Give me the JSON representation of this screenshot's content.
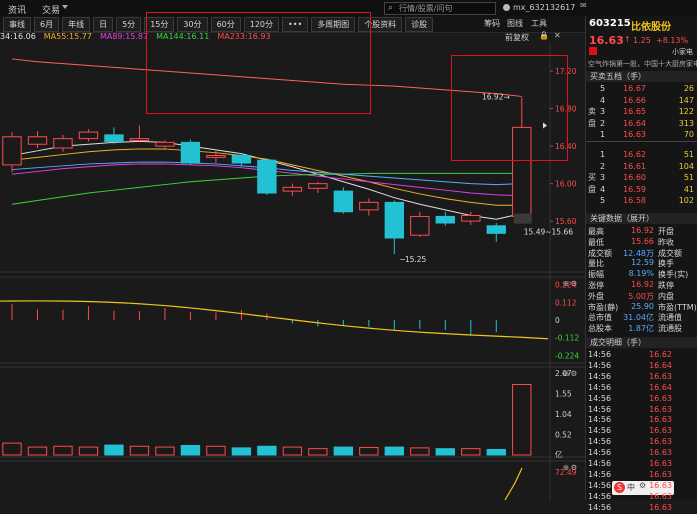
{
  "topbar": {
    "menu": [
      "资讯",
      "交易"
    ],
    "search_placeholder": "行情/股票/问句",
    "account": "mx_632132617",
    "right_tools": [
      "筹码",
      "图线",
      "工具"
    ]
  },
  "toolbar": {
    "buttons": [
      "事线",
      "6月",
      "年线",
      "日",
      "5分",
      "15分",
      "30分",
      "60分",
      "120分",
      "•••",
      "多周期图",
      "个股资料",
      "诊股"
    ],
    "right_label": "前复权"
  },
  "ma_legend": [
    {
      "text": "34:16.06",
      "color": "#e0e0e0"
    },
    {
      "text": "MA55:15.77",
      "color": "#f0b020"
    },
    {
      "text": "MA89:15.87",
      "color": "#e040e0"
    },
    {
      "text": "MA144:16.11",
      "color": "#3ad33a"
    },
    {
      "text": "MA233:16.93",
      "color": "#ff4b4b"
    }
  ],
  "price_axis": [
    "17.20",
    "16.80",
    "16.40",
    "16.00",
    "15.60"
  ],
  "price_annotations": {
    "high": "16.92",
    "low": "15.25",
    "range": "15.49~15.66"
  },
  "macd_axis": [
    "0.224",
    "0.112",
    "0",
    "-0.112",
    "-0.224"
  ],
  "vol_axis": [
    "2.07",
    "1.55",
    "1.04",
    "0.52",
    "亿"
  ],
  "bottom_axis": [
    "72.49"
  ],
  "chart_data": {
    "type": "candlestick",
    "candles": [
      {
        "o": 16.2,
        "c": 16.5,
        "h": 16.55,
        "l": 16.12
      },
      {
        "o": 16.42,
        "c": 16.5,
        "h": 16.56,
        "l": 16.38
      },
      {
        "o": 16.38,
        "c": 16.48,
        "h": 16.52,
        "l": 16.34
      },
      {
        "o": 16.48,
        "c": 16.55,
        "h": 16.58,
        "l": 16.45
      },
      {
        "o": 16.52,
        "c": 16.45,
        "h": 16.6,
        "l": 16.42
      },
      {
        "o": 16.46,
        "c": 16.48,
        "h": 16.62,
        "l": 16.44
      },
      {
        "o": 16.4,
        "c": 16.44,
        "h": 16.46,
        "l": 16.36
      },
      {
        "o": 16.44,
        "c": 16.22,
        "h": 16.47,
        "l": 16.2
      },
      {
        "o": 16.28,
        "c": 16.3,
        "h": 16.35,
        "l": 16.22
      },
      {
        "o": 16.3,
        "c": 16.22,
        "h": 16.32,
        "l": 16.18
      },
      {
        "o": 16.25,
        "c": 15.9,
        "h": 16.27,
        "l": 15.88
      },
      {
        "o": 15.92,
        "c": 15.96,
        "h": 16.0,
        "l": 15.87
      },
      {
        "o": 15.95,
        "c": 16.0,
        "h": 16.02,
        "l": 15.9
      },
      {
        "o": 15.92,
        "c": 15.7,
        "h": 15.96,
        "l": 15.68
      },
      {
        "o": 15.72,
        "c": 15.8,
        "h": 15.84,
        "l": 15.66
      },
      {
        "o": 15.8,
        "c": 15.42,
        "h": 15.82,
        "l": 15.25
      },
      {
        "o": 15.45,
        "c": 15.65,
        "h": 15.7,
        "l": 15.43
      },
      {
        "o": 15.65,
        "c": 15.58,
        "h": 15.7,
        "l": 15.55
      },
      {
        "o": 15.6,
        "c": 15.66,
        "h": 15.7,
        "l": 15.56
      },
      {
        "o": 15.55,
        "c": 15.47,
        "h": 15.58,
        "l": 15.38
      },
      {
        "o": 15.65,
        "c": 16.6,
        "h": 16.92,
        "l": 15.63
      }
    ],
    "volumes": [
      0.3,
      0.2,
      0.22,
      0.2,
      0.25,
      0.22,
      0.2,
      0.24,
      0.22,
      0.18,
      0.22,
      0.2,
      0.16,
      0.2,
      0.19,
      0.2,
      0.18,
      0.16,
      0.16,
      0.14,
      1.78
    ],
    "price_range": [
      15.1,
      17.5
    ],
    "volume_max": 2.07
  },
  "stock": {
    "code": "603215",
    "name": "比依股份",
    "price": "16.63",
    "change": "1.25",
    "pct": "+8.13%",
    "flag": "小家电",
    "desc": "空气炸锅第一股，中国十大厨房家电"
  },
  "order_book": {
    "title": "买卖五档（手）",
    "sell_label": "卖盘",
    "buy_label": "买盘",
    "sells": [
      {
        "n": "5",
        "p": "16.67",
        "v": "26"
      },
      {
        "n": "4",
        "p": "16.66",
        "v": "147"
      },
      {
        "n": "3",
        "p": "16.65",
        "v": "122"
      },
      {
        "n": "2",
        "p": "16.64",
        "v": "313"
      },
      {
        "n": "1",
        "p": "16.63",
        "v": "70"
      }
    ],
    "buys": [
      {
        "n": "1",
        "p": "16.62",
        "v": "51"
      },
      {
        "n": "2",
        "p": "16.61",
        "v": "104"
      },
      {
        "n": "3",
        "p": "16.60",
        "v": "51"
      },
      {
        "n": "4",
        "p": "16.59",
        "v": "41"
      },
      {
        "n": "5",
        "p": "16.58",
        "v": "102"
      }
    ]
  },
  "key_data": {
    "title": "关键数据（展开）",
    "rows": [
      {
        "l1": "最高",
        "v1": "16.92",
        "l2": "开盘",
        "c": "red"
      },
      {
        "l1": "最低",
        "v1": "15.66",
        "l2": "昨收",
        "c": "red"
      },
      {
        "l1": "成交额",
        "v1": "12.48万",
        "l2": "成交额",
        "c": "wht"
      },
      {
        "l1": "量比",
        "v1": "12.59",
        "l2": "换手",
        "c": "wht"
      },
      {
        "l1": "振幅",
        "v1": "8.19%",
        "l2": "换手(实)",
        "c": "wht"
      },
      {
        "l1": "涨停",
        "v1": "16.92",
        "l2": "跌停",
        "c": "red"
      },
      {
        "l1": "外盘",
        "v1": "5.00万",
        "l2": "内盘",
        "c": "red"
      },
      {
        "l1": "市盈(静)",
        "v1": "25.90",
        "l2": "市盈(TTM)",
        "c": "wht"
      },
      {
        "l1": "总市值",
        "v1": "31.04亿",
        "l2": "流通值",
        "c": "wht"
      },
      {
        "l1": "总股本",
        "v1": "1.87亿",
        "l2": "流通股",
        "c": "wht"
      }
    ]
  },
  "ticks": {
    "title": "成交明细（手）",
    "rows": [
      {
        "t": "14:56",
        "p": "16.62"
      },
      {
        "t": "14:56",
        "p": "16.64"
      },
      {
        "t": "14:56",
        "p": "16.63"
      },
      {
        "t": "14:56",
        "p": "16.64"
      },
      {
        "t": "14:56",
        "p": "16.63"
      },
      {
        "t": "14:56",
        "p": "16.63"
      },
      {
        "t": "14:56",
        "p": "16.63"
      },
      {
        "t": "14:56",
        "p": "16.63"
      },
      {
        "t": "14:56",
        "p": "16.63"
      },
      {
        "t": "14:56",
        "p": "16.63"
      },
      {
        "t": "14:56",
        "p": "16.63"
      },
      {
        "t": "14:56",
        "p": "16.63"
      },
      {
        "t": "14:56",
        "p": "16.63"
      },
      {
        "t": "14:56",
        "p": "16.63"
      },
      {
        "t": "14:56",
        "p": "16.63"
      }
    ]
  },
  "ime": {
    "label": "中"
  }
}
